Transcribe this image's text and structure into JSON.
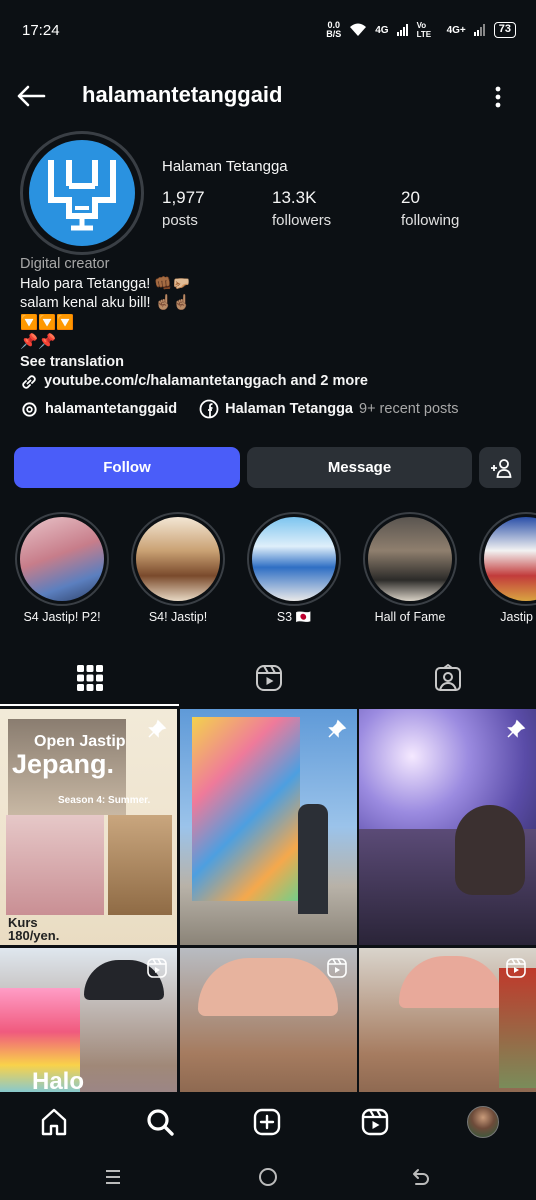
{
  "status": {
    "time": "17:24",
    "net_speed_top": "0.0",
    "net_speed_bottom": "B/S",
    "net1": "4G",
    "net2": "Vo LTE",
    "net3": "4G+",
    "battery": "73"
  },
  "header": {
    "username": "halamantetanggaid"
  },
  "profile": {
    "display_name": "Halaman Tetangga",
    "stats": [
      {
        "value": "1,977",
        "label": "posts"
      },
      {
        "value": "13.3K",
        "label": "followers"
      },
      {
        "value": "20",
        "label": "following"
      }
    ],
    "category": "Digital creator",
    "bio_lines": [
      "Halo para Tetangga! 👊🏾🤛🏼",
      "salam kenal aku bill! ☝🏽☝🏽",
      "🔽🔽🔽",
      "📌📌"
    ],
    "see_translation": "See translation",
    "link_text": "youtube.com/c/halamantetanggach and 2 more",
    "threads_handle": "halamantetanggaid",
    "facebook_name": "Halaman Tetangga",
    "facebook_suffix": "9+ recent posts"
  },
  "actions": {
    "follow": "Follow",
    "message": "Message"
  },
  "highlights": [
    {
      "label": "S4 Jastip! P2!"
    },
    {
      "label": "S4! Jastip!"
    },
    {
      "label": "S3 🇯🇵"
    },
    {
      "label": "Hall of Fame"
    },
    {
      "label": "Jastip Se"
    }
  ],
  "grid": {
    "post1": {
      "title1": "Open Jastip",
      "title2": "Jepang.",
      "subtitle": "Season 4: Summer.",
      "kurs1": "Kurs",
      "kurs2": "180/yen."
    },
    "post4": {
      "caption": "Halo"
    }
  },
  "colors": {
    "follow": "#4a5df9",
    "background": "#0c1014",
    "button_dark": "#2b3036"
  }
}
